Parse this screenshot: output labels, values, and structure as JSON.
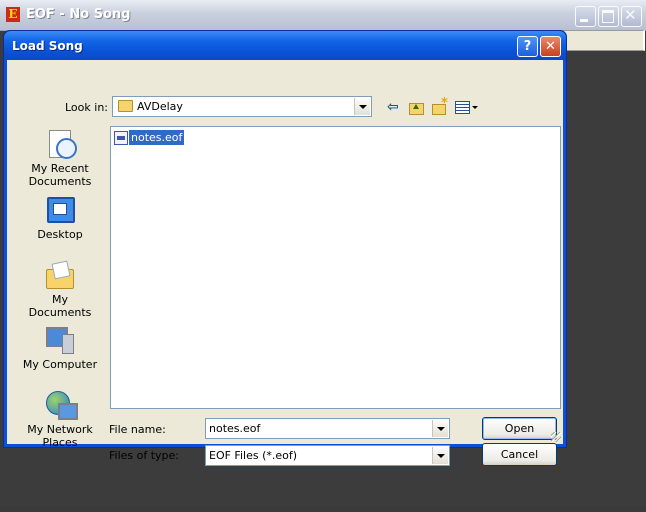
{
  "main_window": {
    "title": "EOF - No Song",
    "app_icon_glyph": "E"
  },
  "dialog": {
    "title": "Load Song",
    "help_glyph": "?",
    "close_glyph": "✕",
    "look_in": {
      "label": "Look in:",
      "value": "AVDelay"
    },
    "toolbar": {
      "back_glyph": "⇦"
    },
    "places": [
      {
        "label": "My Recent Documents",
        "icon": "recent-documents-icon"
      },
      {
        "label": "Desktop",
        "icon": "desktop-icon"
      },
      {
        "label": "My Documents",
        "icon": "my-documents-icon"
      },
      {
        "label": "My Computer",
        "icon": "my-computer-icon"
      },
      {
        "label": "My Network Places",
        "icon": "network-places-icon"
      }
    ],
    "files": [
      {
        "name": "notes.eof",
        "selected": true
      }
    ],
    "file_name": {
      "label": "File name:",
      "value": "notes.eof"
    },
    "file_type": {
      "label": "Files of type:",
      "value": "EOF Files (*.eof)"
    },
    "buttons": {
      "open": "Open",
      "cancel": "Cancel"
    }
  },
  "colors": {
    "title_bar_blue": "#0a53d7",
    "dialog_face": "#ece9d8",
    "selection": "#316ac5",
    "background": "#3c3c3c"
  }
}
